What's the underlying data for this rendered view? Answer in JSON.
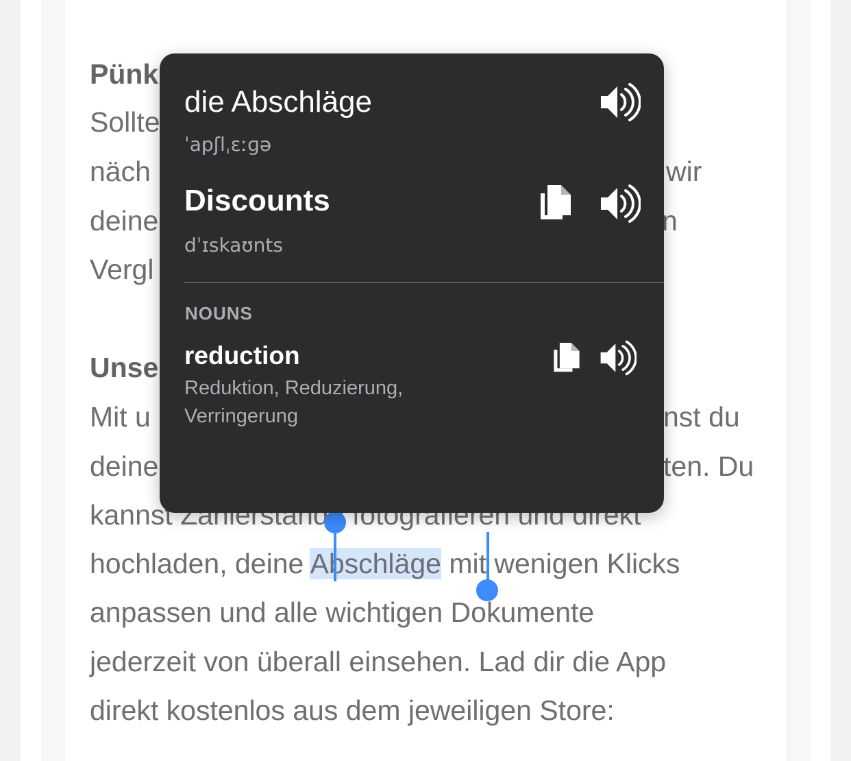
{
  "article": {
    "heading1": "Pünk",
    "lines_block1": [
      "Sollte",
      "näch",
      "deine",
      "Vergl"
    ],
    "right_fragments_block1": [
      "wir",
      "n"
    ],
    "heading2": "Unse",
    "line_mit": "Mit u",
    "right_fragment_mit": "nst du",
    "line_deine": "deine",
    "right_fragment_deine": "ten. Du",
    "line_kannst": "kannst Zählerstände fotografieren und direkt",
    "line_hochladen_before": "hochladen, deine ",
    "selected_word": "Abschläge",
    "line_hochladen_after": " mit wenigen Klicks",
    "line_anpassen": "anpassen und alle wichtigen Dokumente",
    "line_jederzeit": "jederzeit von überall einsehen. Lad dir die App",
    "line_direkt": "direkt kostenlos aus dem jeweiligen Store:"
  },
  "popover": {
    "source_word": "die Abschläge",
    "source_ipa": "ˈapʃlˌɛːɡə",
    "translation": "Discounts",
    "translation_ipa": "dˈɪskaʊnts",
    "section_label": "NOUNS",
    "entries": [
      {
        "word": "reduction",
        "synonyms": "Reduktion, Reduzierung, Verringerung"
      }
    ]
  },
  "icons": {
    "speaker": "speaker-icon",
    "copy": "copy-icon"
  },
  "colors": {
    "popover_bg": "#2c2c2e",
    "selection_highlight": "#d4e6fb",
    "selection_handle": "#3d8bfd",
    "body_text": "#6e6e73"
  }
}
